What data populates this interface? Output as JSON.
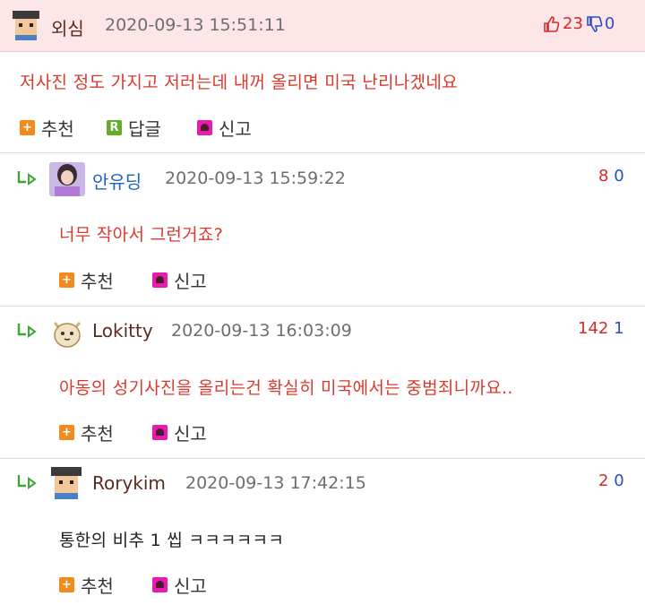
{
  "post": {
    "author": "외심",
    "time": "2020-09-13 15:51:11",
    "up": "23",
    "down": "0",
    "body": "저사진 정도 가지고 저러는데 내꺼 올리면 미국 난리나겠네요",
    "actions": {
      "recommend": "추천",
      "reply": "답글",
      "report": "신고"
    }
  },
  "replies": [
    {
      "author": "안유딩",
      "time": "2020-09-13 15:59:22",
      "up": "8",
      "down": "0",
      "body": "너무 작아서 그런거죠?",
      "recommend": "추천",
      "report": "신고"
    },
    {
      "author": "Lokitty",
      "time": "2020-09-13 16:03:09",
      "up": "142",
      "down": "1",
      "body": "아동의 성기사진을 올리는건 확실히 미국에서는 중범죄니까요..",
      "recommend": "추천",
      "report": "신고"
    },
    {
      "author": "Rorykim",
      "time": "2020-09-13 17:42:15",
      "up": "2",
      "down": "0",
      "body": "통한의 비추 1 씹 ㅋㅋㅋㅋㅋㅋ",
      "recommend": "추천",
      "report": "신고"
    }
  ],
  "icons": {
    "reply_arrow": "reply-arrow-icon",
    "thumb_up": "thumbs-up-icon",
    "thumb_down": "thumbs-down-icon",
    "recommend": "plus-icon",
    "reply": "reply-r-icon",
    "report": "siren-icon"
  },
  "colors": {
    "header_bg": "#fde6e7",
    "body_red": "#d83a2e",
    "up_red": "#d42a2a",
    "down_blue": "#2a4fc2",
    "reply_green": "#3fa534"
  }
}
